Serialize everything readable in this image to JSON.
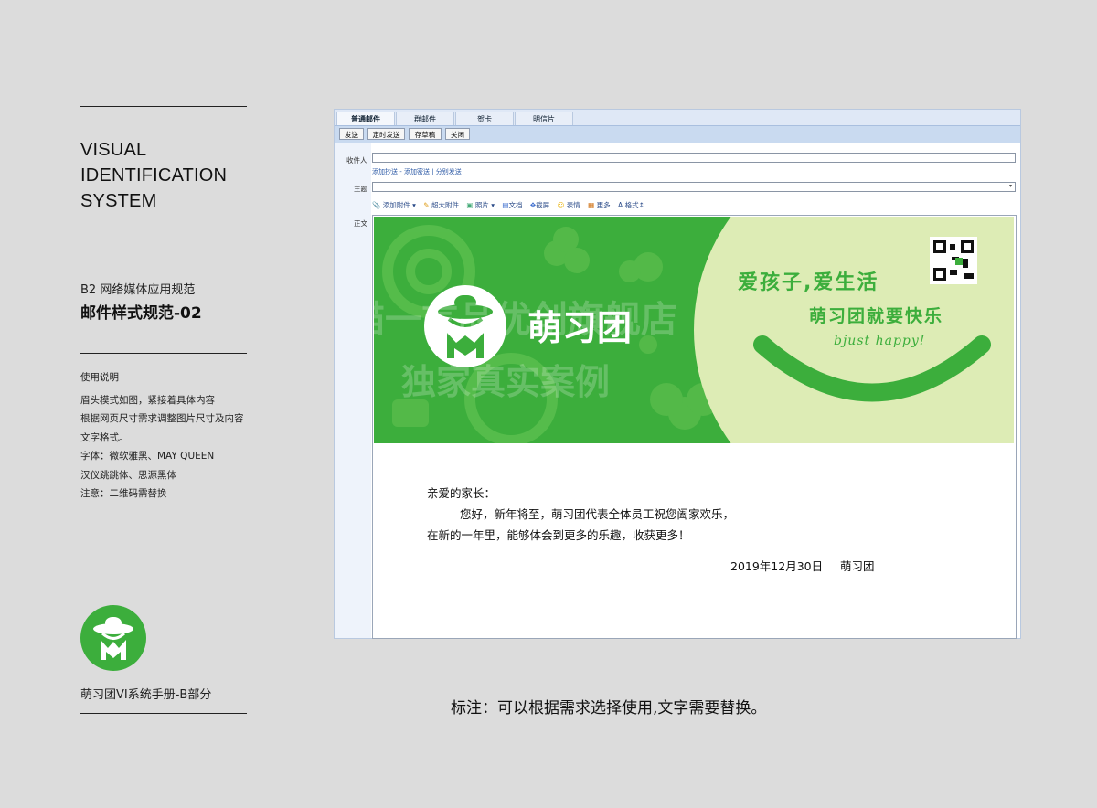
{
  "left_panel": {
    "title_lines": [
      "VISUAL",
      "IDENTIFICATION",
      "SYSTEM"
    ],
    "section_label": "B2 网络媒体应用规范",
    "section_title": "邮件样式规范-02",
    "notes_title": "使用说明",
    "notes_lines": [
      "眉头模式如图，紧接着具体内容",
      "根据网页尺寸需求调整图片尺寸及内容",
      "文字格式。",
      "字体：微软雅黑、MAY QUEEN",
      "汉仪跳跳体、思源黑体",
      "注意：二维码需替换"
    ],
    "brand_caption": "萌习团VI系统手册-B部分"
  },
  "mail": {
    "tabs": [
      "普通邮件",
      "群邮件",
      "贺卡",
      "明信片"
    ],
    "toolbar": [
      "发送",
      "定时发送",
      "存草稿",
      "关闭"
    ],
    "recipient_label": "收件人",
    "recipient_links": "添加抄送 - 添加密送 | 分别发送",
    "subject_label": "主题",
    "body_label": "正文",
    "format_tools": [
      "添加附件",
      "超大附件",
      "照片",
      "文档",
      "截屏",
      "表情",
      "更多",
      "格式"
    ],
    "banner": {
      "brand_name": "萌习团",
      "slogan_1": "爱孩子,爱生活",
      "slogan_2": "萌习团就要快乐",
      "slogan_3": "bjust happy!",
      "watermark_1": "天猫一言品优创旗舰店",
      "watermark_2": "独家真实案例"
    },
    "letter": {
      "greeting": "亲爱的家长：",
      "line1": "您好，新年将至，萌习团代表全体员工祝您阖家欢乐，",
      "line2": "在新的一年里，能够体会到更多的乐趣，收获更多！",
      "date": "2019年12月30日",
      "signature": "萌习团"
    }
  },
  "footnote": "标注：可以根据需求选择使用,文字需要替换。",
  "colors": {
    "brand_green": "#3cae3c",
    "light_green": "#ddecb5",
    "background": "#dcdcdc"
  }
}
